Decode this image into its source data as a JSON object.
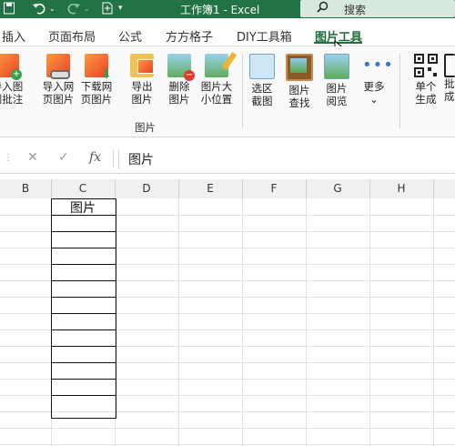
{
  "titlebar": {
    "title": "工作簿1  -  Excel",
    "search_placeholder": "搜索",
    "icons": [
      "excel-save-icon",
      "undo-icon",
      "redo-icon",
      "new-file-icon",
      "customize-qat-icon",
      "search-icon"
    ]
  },
  "tabs": [
    {
      "label": "插入",
      "active": false
    },
    {
      "label": "页面布局",
      "active": false
    },
    {
      "label": "公式",
      "active": false
    },
    {
      "label": "方方格子",
      "active": false
    },
    {
      "label": "DIY工具箱",
      "active": false
    },
    {
      "label": "图片工具",
      "active": true
    }
  ],
  "ribbon": {
    "buttons": [
      {
        "line1": "导入图",
        "line2": "到批注",
        "icon": "import-to-comment-icon"
      },
      {
        "line1": "导入网",
        "line2": "页图片",
        "icon": "import-web-image-icon"
      },
      {
        "line1": "下载网",
        "line2": "页图片",
        "icon": "download-web-image-icon"
      },
      {
        "line1": "导出",
        "line2": "图片",
        "icon": "export-image-icon"
      },
      {
        "line1": "删除",
        "line2": "图片",
        "icon": "delete-image-icon"
      },
      {
        "line1": "图片大",
        "line2": "小位置",
        "icon": "image-size-position-icon"
      },
      {
        "line1": "选区",
        "line2": "截图",
        "icon": "screenshot-selection-icon"
      },
      {
        "line1": "图片",
        "line2": "查找",
        "icon": "image-find-icon"
      },
      {
        "line1": "图片",
        "line2": "阅览",
        "icon": "image-view-icon"
      },
      {
        "line1": "更多",
        "line2": "",
        "icon": "more-icon"
      },
      {
        "line1": "单个",
        "line2": "生成",
        "icon": "qr-single-icon"
      },
      {
        "line1": "批",
        "line2": "成",
        "icon": "qr-batch-icon"
      }
    ],
    "group_label": "图片"
  },
  "formula_bar": {
    "content": "图片",
    "cancel_symbol": "✕",
    "confirm_symbol": "✓",
    "fx_symbol": "fx"
  },
  "columns": [
    "B",
    "C",
    "D",
    "E",
    "F",
    "G",
    "H"
  ],
  "cells": {
    "C1": "图片"
  },
  "colors": {
    "accent": "#217346",
    "active_tab": "#1a6c3a",
    "search_bg": "#d7e9dc"
  }
}
